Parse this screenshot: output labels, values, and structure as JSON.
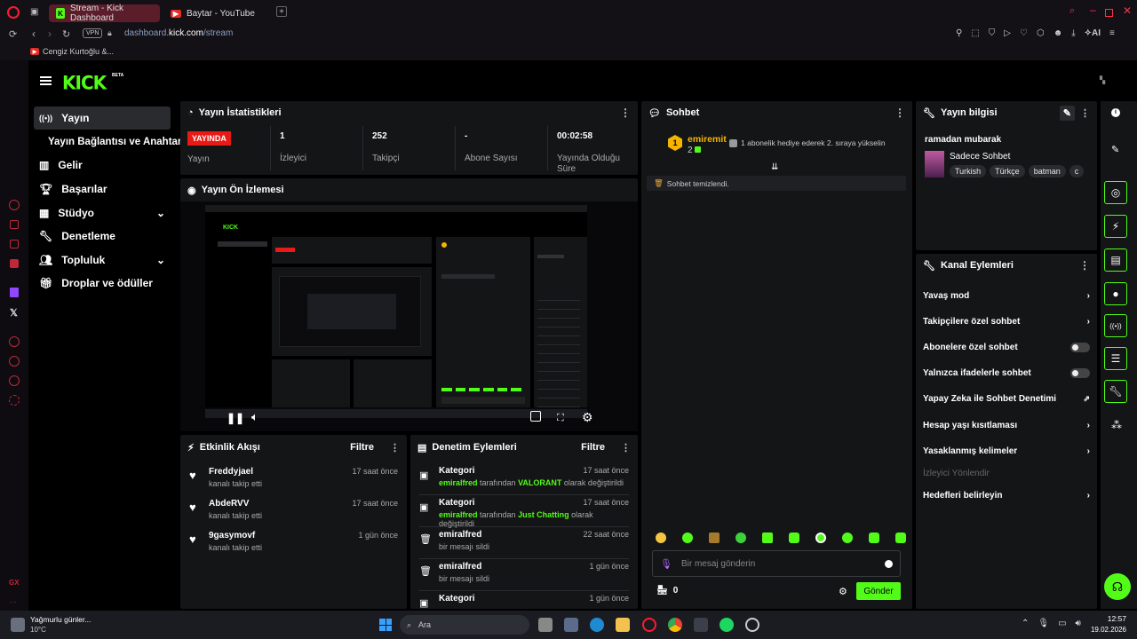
{
  "browser": {
    "tabs": [
      {
        "label": "Stream - Kick Dashboard",
        "active": true
      },
      {
        "label": "Baytar - YouTube",
        "active": false
      }
    ],
    "url_prefix": "dashboard.",
    "url_domain": "kick.com",
    "url_path": "/stream",
    "vpn": "VPN",
    "ai_label": "AI",
    "bookmark": "Cengiz Kurtoğlu &...",
    "opera_gx": "GX"
  },
  "logo": {
    "text": "KICK",
    "badge": "BETA"
  },
  "nav": [
    {
      "label": "Yayın",
      "selected": true,
      "icon": "broadcast-icon"
    },
    {
      "label": "Yayın Bağlantısı ve Anahtarı",
      "sub": true
    },
    {
      "label": "Gelir",
      "icon": "chart-icon"
    },
    {
      "label": "Başarılar",
      "icon": "trophy-icon"
    },
    {
      "label": "Stüdyo",
      "icon": "grid-icon",
      "expand": true
    },
    {
      "label": "Denetleme",
      "icon": "wrench-icon"
    },
    {
      "label": "Topluluk",
      "icon": "people-icon",
      "expand": true
    },
    {
      "label": "Droplar ve ödüller",
      "icon": "gift-icon"
    }
  ],
  "stats": {
    "title": "Yayın İstatistikleri",
    "live_badge": "YAYINDA",
    "items": [
      {
        "value": "",
        "label": "Yayın"
      },
      {
        "value": "1",
        "label": "İzleyici"
      },
      {
        "value": "252",
        "label": "Takipçi"
      },
      {
        "value": "-",
        "label": "Abone Sayısı"
      },
      {
        "value": "00:02:58",
        "label": "Yayında Olduğu Süre"
      }
    ]
  },
  "preview": {
    "title": "Yayın Ön İzlemesi"
  },
  "activity": {
    "title": "Etkinlik Akışı",
    "filter": "Filtre",
    "rows": [
      {
        "name": "Freddyjael",
        "sub": "kanalı takip etti",
        "time": "17 saat önce"
      },
      {
        "name": "AbdeRVV",
        "sub": "kanalı takip etti",
        "time": "17 saat önce"
      },
      {
        "name": "9gasymovf",
        "sub": "kanalı takip etti",
        "time": "1 gün önce"
      }
    ]
  },
  "moderation": {
    "title": "Denetim Eylemleri",
    "filter": "Filtre",
    "rows": [
      {
        "name": "Kategori",
        "user": "emiralfred",
        "mid": " tarafından ",
        "val": "VALORANT",
        "end": " olarak değiştirildi",
        "time": "17 saat önce",
        "icon": "category-icon"
      },
      {
        "name": "Kategori",
        "user": "emiralfred",
        "mid": " tarafından ",
        "val": "Just Chatting",
        "end": " olarak değiştirildi",
        "time": "17 saat önce",
        "icon": "category-icon"
      },
      {
        "name": "emiralfred",
        "user": "",
        "mid": "bir mesajı sildi",
        "val": "",
        "end": "",
        "time": "22 saat önce",
        "icon": "trash-icon"
      },
      {
        "name": "emiralfred",
        "user": "",
        "mid": "bir mesajı sildi",
        "val": "",
        "end": "",
        "time": "1 gün önce",
        "icon": "trash-icon"
      },
      {
        "name": "Kategori",
        "user": "",
        "mid": "",
        "val": "",
        "end": "",
        "time": "1 gün önce",
        "icon": "category-icon"
      }
    ]
  },
  "chat": {
    "title": "Sohbet",
    "pinned_user": "emiremit",
    "pinned_count": "2",
    "gift_text": "1 abonelik hediye ederek 2. sıraya yükselin",
    "cleared": "Sohbet temizlendi.",
    "placeholder": "Bir mesaj gönderin",
    "points": "0",
    "send": "Gönder"
  },
  "info": {
    "title": "Yayın bilgisi",
    "stream_title": "ramadan mubarak",
    "category": "Sadece Sohbet",
    "tags": [
      "Turkish",
      "Türkçe",
      "batman",
      "c"
    ]
  },
  "channel_actions": {
    "title": "Kanal Eylemleri",
    "items": [
      {
        "label": "Yavaş mod",
        "type": "chevron"
      },
      {
        "label": "Takipçilere özel sohbet",
        "type": "chevron"
      },
      {
        "label": "Abonelere özel sohbet",
        "type": "toggle"
      },
      {
        "label": "Yalnızca ifadelerle sohbet",
        "type": "toggle"
      },
      {
        "label": "Yapay Zeka ile Sohbet Denetimi",
        "type": "external"
      },
      {
        "label": "Hesap yaşı kısıtlaması",
        "type": "chevron"
      },
      {
        "label": "Yasaklanmış kelimeler",
        "type": "chevron"
      },
      {
        "label": "İzleyici Yönlendir",
        "type": "disabled"
      },
      {
        "label": "Hedefleri belirleyin",
        "type": "chevron"
      }
    ]
  },
  "taskbar": {
    "weather_title": "Yağmurlu günler...",
    "weather_temp": "10°C",
    "search": "Ara",
    "time": "12:57",
    "date": "19.02.2026"
  },
  "colors": {
    "accent": "#53fc18",
    "live": "#e91916",
    "opera": "#ff1b2d"
  }
}
